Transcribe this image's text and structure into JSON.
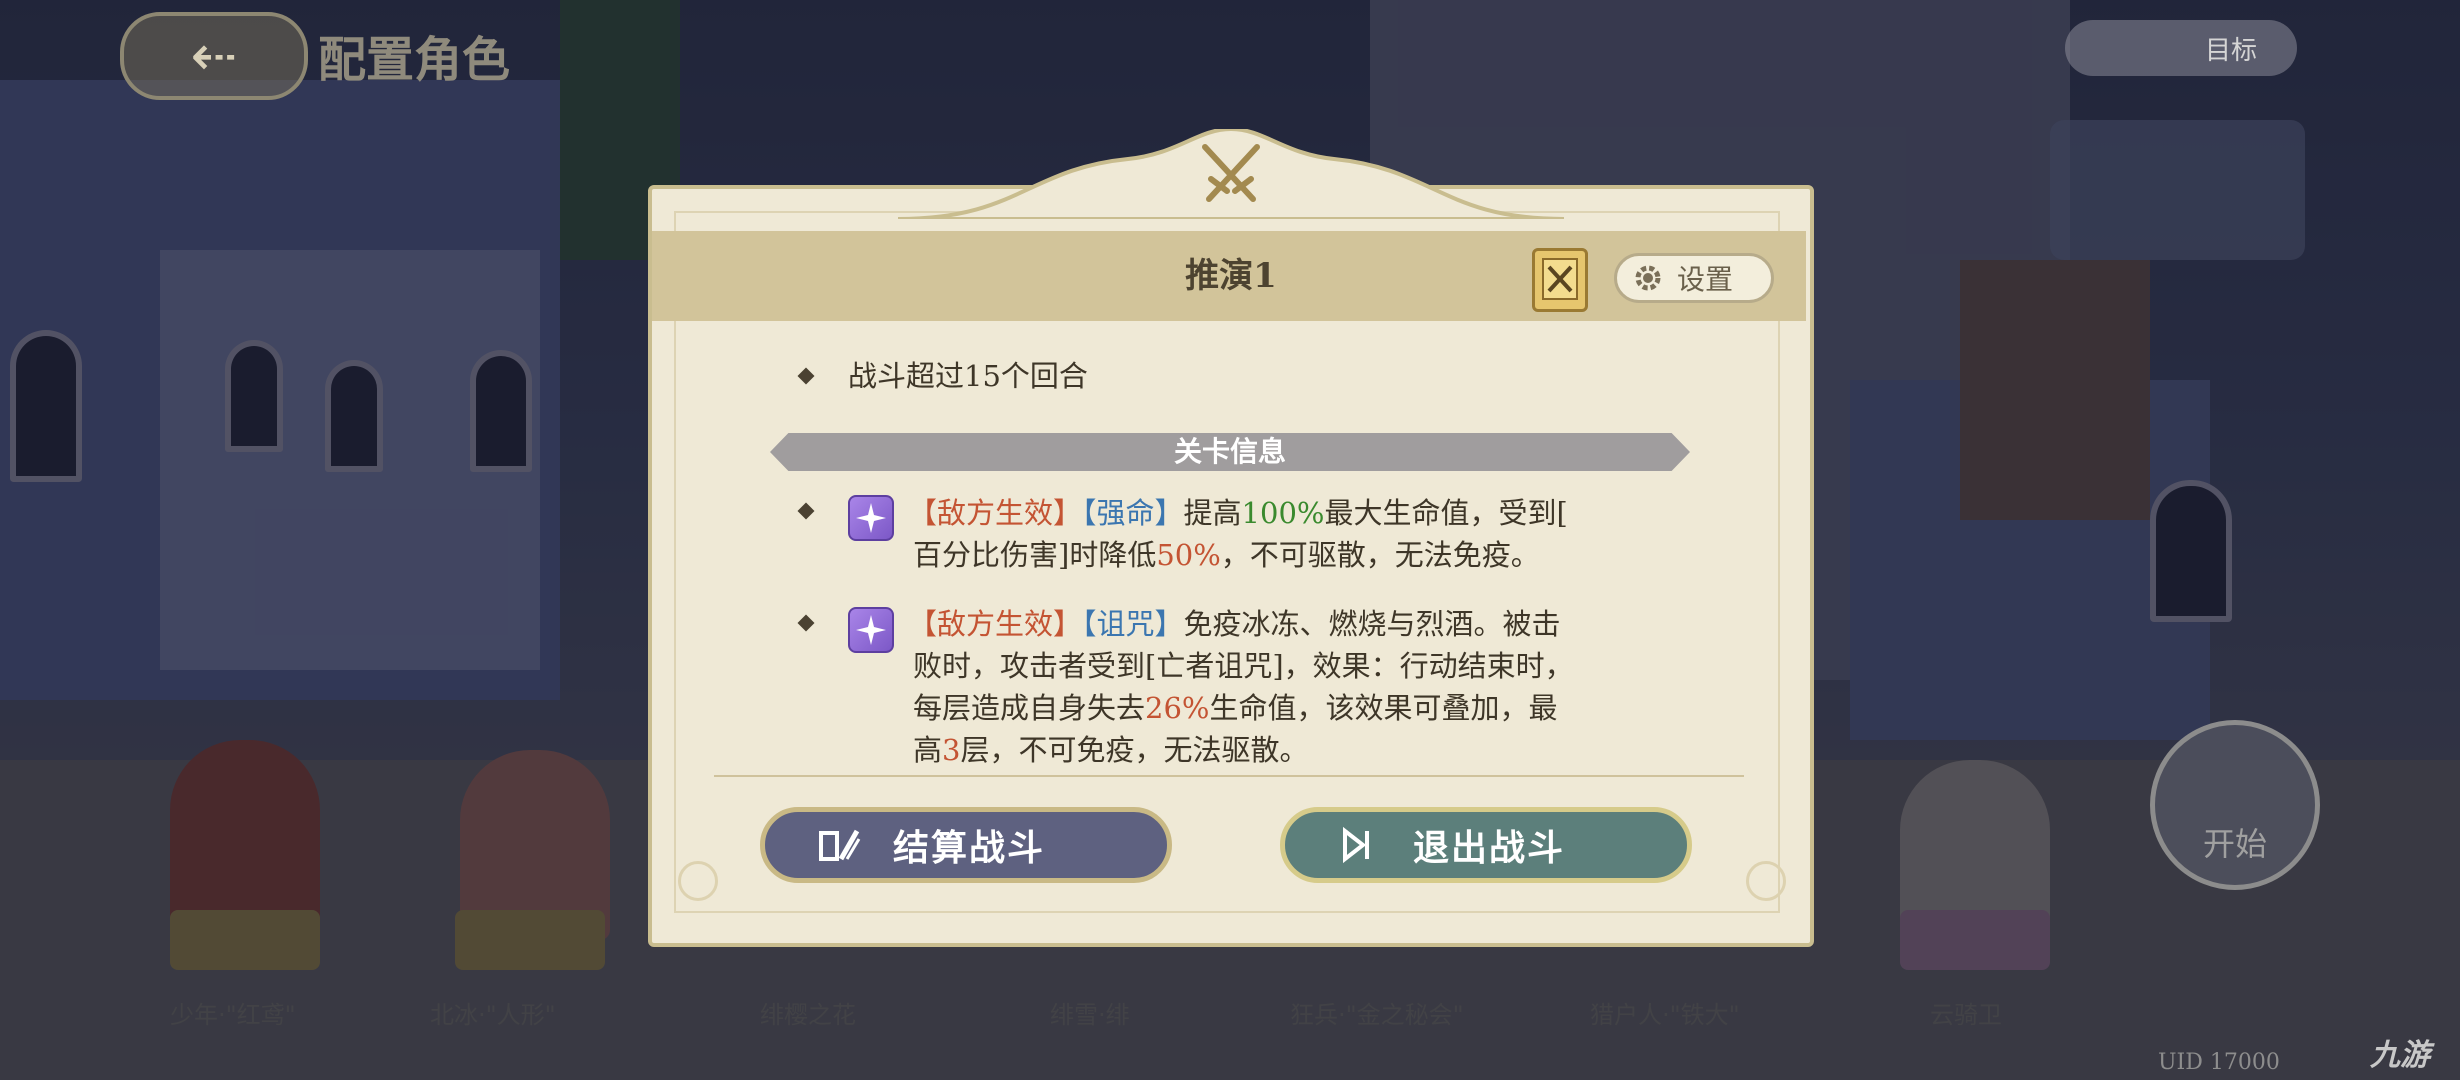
{
  "background": {
    "page_title": "配置角色",
    "top_right_label": "目标",
    "uid_text": "UID 17000",
    "watermark": "九游",
    "start_label": "开始",
    "characters": [
      {
        "name": "少年·\"红鸢\""
      },
      {
        "name": "北冰·\"人形\""
      },
      {
        "name": "绯樱之花"
      },
      {
        "name": "绯雪·绯"
      },
      {
        "name": "狂兵·\"金之秘会\""
      },
      {
        "name": "猎户人·\"铁大\""
      },
      {
        "name": "云骑卫"
      }
    ]
  },
  "dialog": {
    "title": "推演1",
    "settings_label": "设置",
    "condition_text": "战斗超过15个回合",
    "section_label": "关卡信息",
    "effects": [
      {
        "tag1": "【敌方生效】",
        "tag2": "【强命】",
        "line1_a": "提高",
        "line1_val": "100%",
        "line1_b": "最大生命值，受到[",
        "line2_a": "百分比伤害]时降低",
        "line2_val": "50%",
        "line2_b": "，不可驱散，无法免疫。"
      },
      {
        "tag1": "【敌方生效】",
        "tag2": "【诅咒】",
        "line1_a": "免疫冰冻、燃烧与烈酒。被击",
        "line2": "败时，攻击者受到[亡者诅咒]，效果：行动结束时，",
        "line3_a": "每层造成自身失去",
        "line3_val": "26%",
        "line3_b": "生命值，该效果可叠加，最",
        "line4_a": "高",
        "line4_val": "3",
        "line4_b": "层，不可免疫，无法驱散。"
      }
    ],
    "settle_label": "结算战斗",
    "exit_label": "退出战斗"
  },
  "colors": {
    "accent_red": "#c45433",
    "accent_blue": "#3b76b0",
    "accent_green": "#3a8a2e",
    "panel_bg": "#efe9d6",
    "header_band": "#d2c49a"
  }
}
